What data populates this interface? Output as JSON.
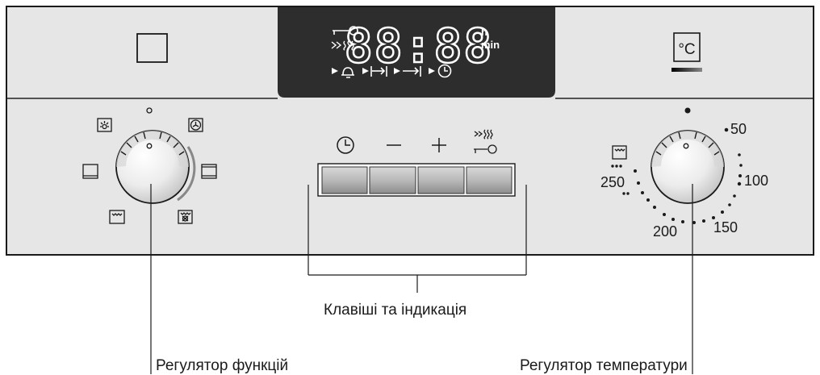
{
  "display": {
    "digits": "88:88",
    "unit_hours": "h",
    "unit_minutes": "min"
  },
  "temperature_scale": {
    "unit_symbol": "°C",
    "marks": [
      "50",
      "100",
      "150",
      "200",
      "250"
    ]
  },
  "labels": {
    "keys_and_display": "Клавіші та індикація",
    "function_selector": "Регулятор функцій",
    "temperature_selector": "Регулятор температури"
  },
  "icons": {
    "display_row1": [
      "key-lock-icon",
      "rapid-heat-icon"
    ],
    "display_row2": [
      "alarm-bell-icon",
      "cooking-time-icon",
      "end-time-icon",
      "clock-time-icon"
    ],
    "buttons": [
      "clock-icon",
      "minus-icon",
      "plus-icon",
      "rapid-heat-lock-icon"
    ],
    "function_modes": [
      "oven-light-icon",
      "hot-air-icon",
      "top-bottom-heat-icon",
      "bottom-heat-icon",
      "grill-icon",
      "hot-air-grill-icon",
      "conventional-heat-icon"
    ]
  },
  "colors": {
    "panel": "#e6e6e6",
    "display_bg": "#2d2d2d",
    "display_segments": "#ffffff",
    "outline": "#1a1a1a"
  }
}
